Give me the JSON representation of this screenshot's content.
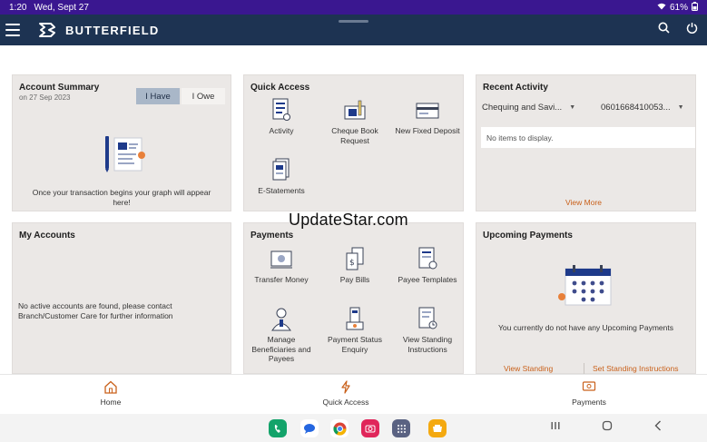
{
  "status_bar": {
    "time": "1:20",
    "date": "Wed, Sept 27",
    "battery": "61%",
    "wifi_icon": "wifi-icon",
    "battery_icon": "battery-icon"
  },
  "app_bar": {
    "brand": "BUTTERFIELD",
    "menu_icon": "hamburger-icon",
    "search_icon": "search-icon",
    "power_icon": "power-icon"
  },
  "account_summary": {
    "title": "Account Summary",
    "date": "on 27 Sep 2023",
    "toggle": [
      "I Have",
      "I Owe"
    ],
    "selected": "I Have",
    "empty_message": "Once your transaction begins your graph will appear here!"
  },
  "quick_access": {
    "title": "Quick Access",
    "items": [
      {
        "label": "Activity",
        "icon": "activity-icon"
      },
      {
        "label": "Cheque Book Request",
        "icon": "cheque-book-icon"
      },
      {
        "label": "New Fixed Deposit",
        "icon": "fixed-deposit-icon"
      },
      {
        "label": "E-Statements",
        "icon": "e-statements-icon"
      }
    ]
  },
  "recent_activity": {
    "title": "Recent Activity",
    "account_type": "Chequing and Savi...",
    "account_number": "0601668410053...",
    "no_items": "No items to display.",
    "view_more": "View More"
  },
  "my_accounts": {
    "title": "My Accounts",
    "message": "No active accounts are found, please contact Branch/Customer Care for further information"
  },
  "payments": {
    "title": "Payments",
    "items": [
      {
        "label": "Transfer Money",
        "icon": "transfer-money-icon"
      },
      {
        "label": "Pay Bills",
        "icon": "pay-bills-icon"
      },
      {
        "label": "Payee Templates",
        "icon": "payee-templates-icon"
      },
      {
        "label": "Manage Beneficiaries and Payees",
        "icon": "manage-beneficiaries-icon"
      },
      {
        "label": "Payment Status Enquiry",
        "icon": "payment-status-icon"
      },
      {
        "label": "View Standing Instructions",
        "icon": "standing-instructions-icon"
      }
    ]
  },
  "upcoming_payments": {
    "title": "Upcoming Payments",
    "message": "You currently do not have any Upcoming Payments",
    "link_left": "View Standing",
    "link_right": "Set Standing Instructions"
  },
  "watermark": "UpdateStar.com",
  "tabs": [
    {
      "label": "Home",
      "icon": "home-icon"
    },
    {
      "label": "Quick Access",
      "icon": "lightning-icon"
    },
    {
      "label": "Payments",
      "icon": "payments-icon"
    }
  ],
  "colors": {
    "status_bar": "#3a1790",
    "app_bar": "#1d3352",
    "card_bg": "#ebe8e6",
    "link": "#c9601a",
    "toggle_selected": "#a9b7c8"
  }
}
